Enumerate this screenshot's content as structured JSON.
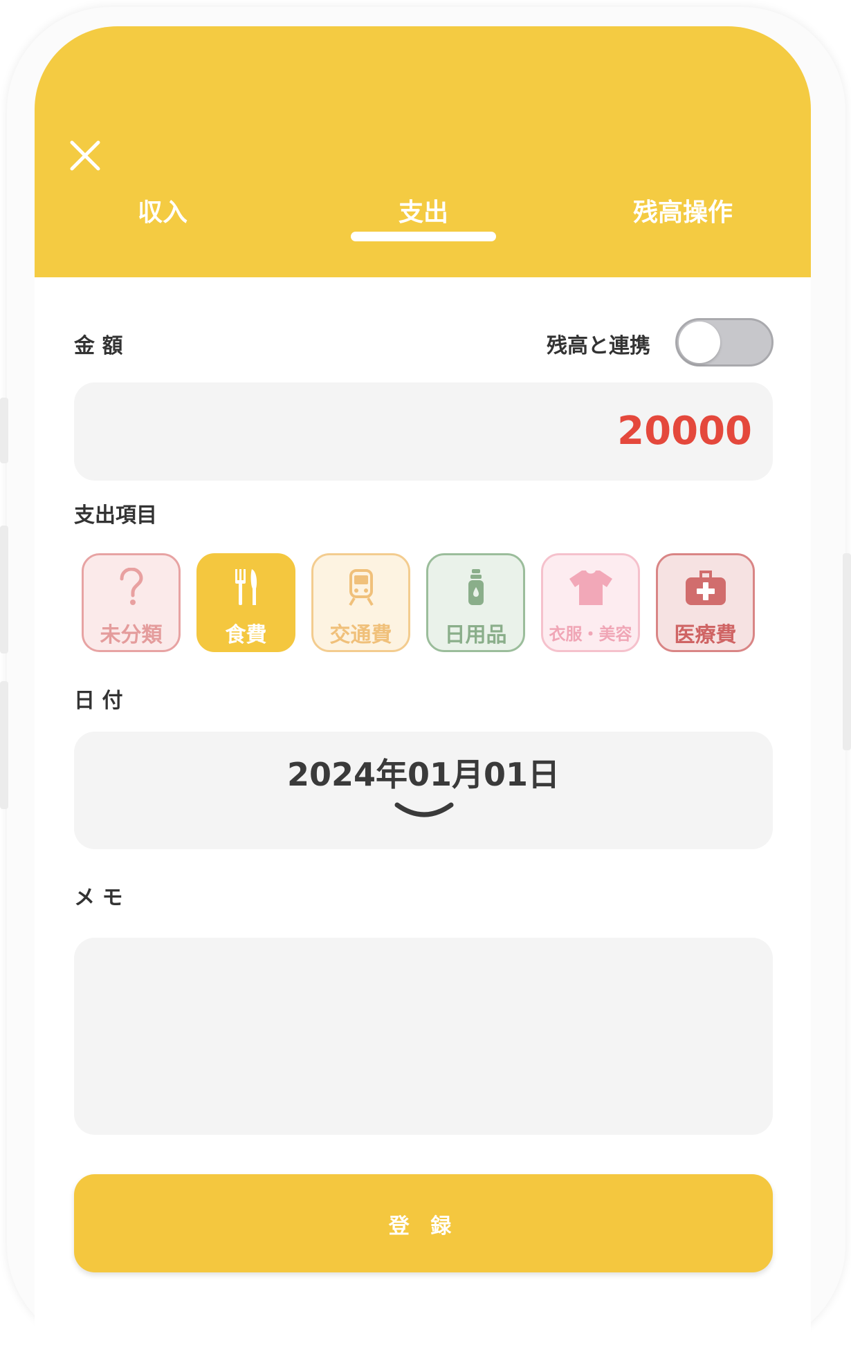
{
  "header": {
    "tabs": [
      {
        "label": "収入"
      },
      {
        "label": "支出",
        "active": true
      },
      {
        "label": "残高操作"
      }
    ],
    "accent_color": "#f4cb42"
  },
  "amount": {
    "label": "金 額",
    "link_label": "残高と連携",
    "link_enabled": false,
    "value": "20000",
    "value_color": "#e4483c"
  },
  "category": {
    "label": "支出項目",
    "items": [
      {
        "label": "未分類",
        "icon": "question-icon",
        "selected": false
      },
      {
        "label": "食費",
        "icon": "fork-knife-icon",
        "selected": true
      },
      {
        "label": "交通費",
        "icon": "train-icon",
        "selected": false
      },
      {
        "label": "日用品",
        "icon": "bottle-icon",
        "selected": false
      },
      {
        "label": "衣服・美容",
        "icon": "shirt-icon",
        "selected": false
      },
      {
        "label": "医療費",
        "icon": "medical-kit-icon",
        "selected": false
      }
    ]
  },
  "date": {
    "label": "日 付",
    "value": "2024年01月01日"
  },
  "memo": {
    "label": "メ モ",
    "value": ""
  },
  "submit": {
    "label": "登 録"
  }
}
